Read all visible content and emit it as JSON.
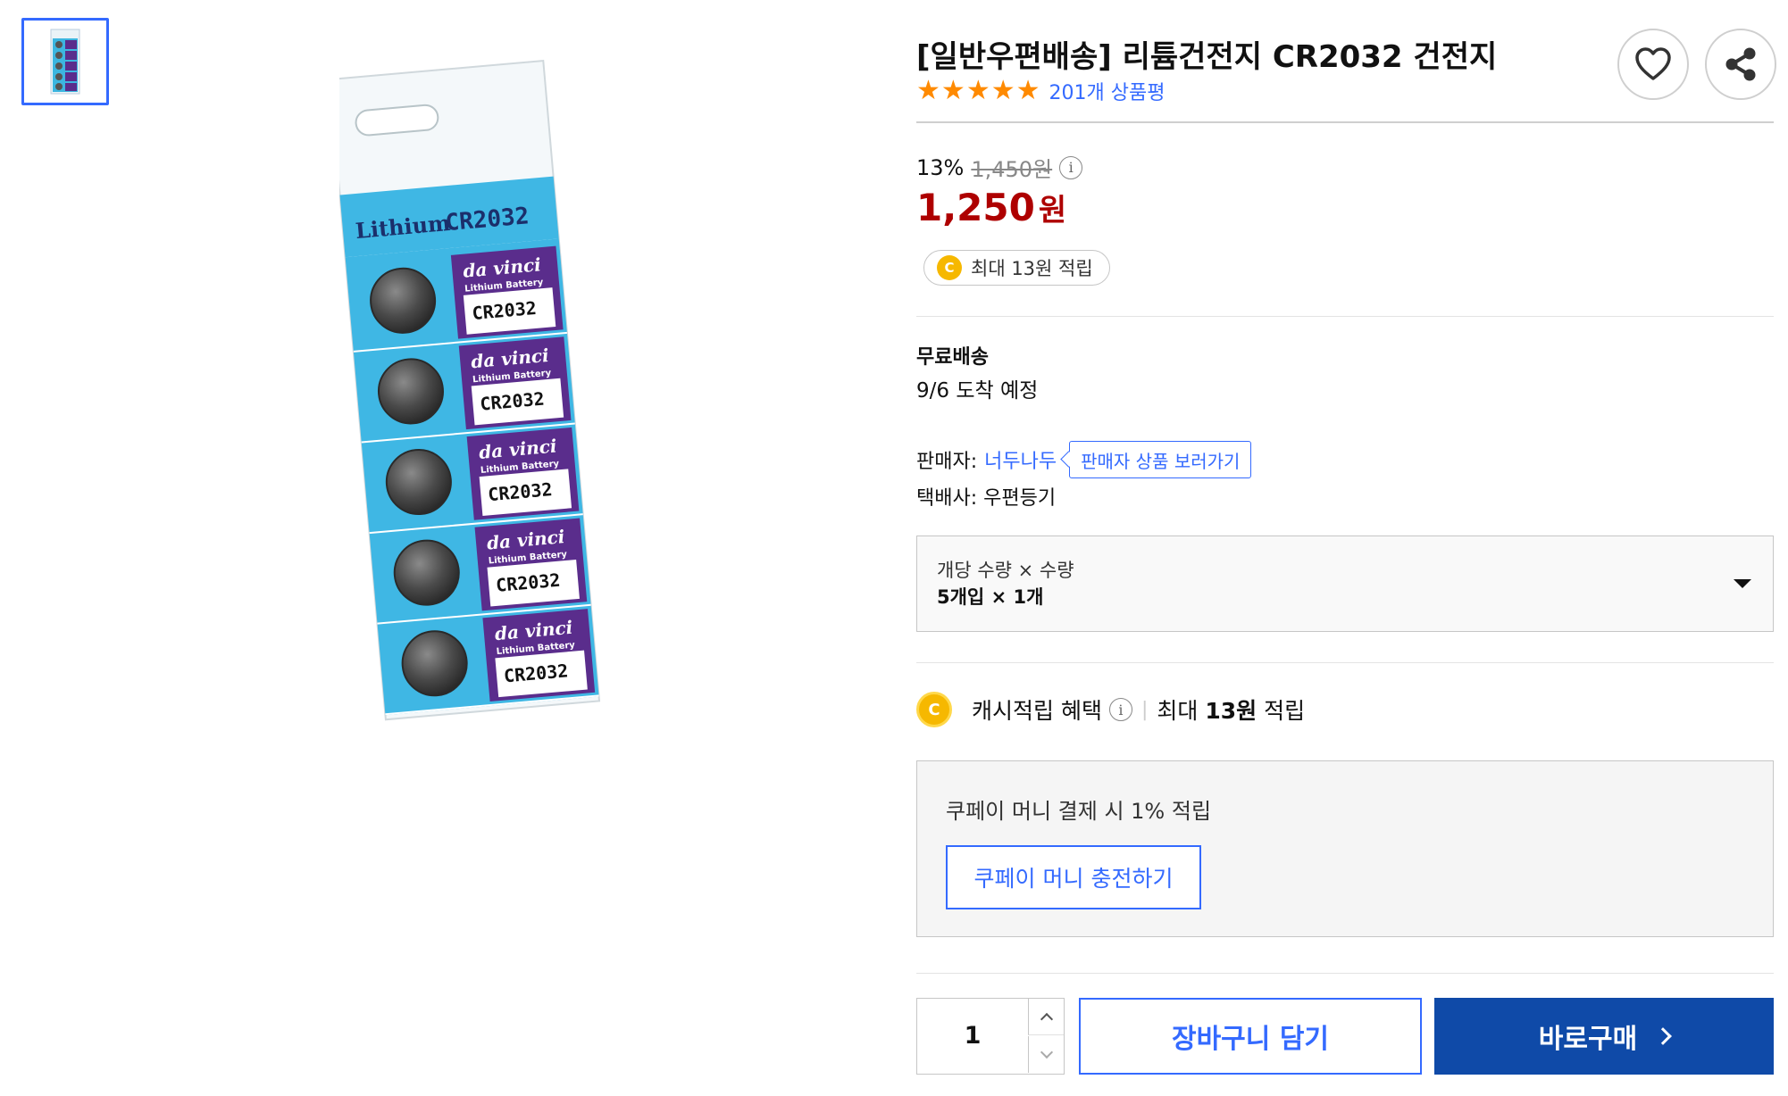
{
  "gallery": {
    "brand_label": "Lithium",
    "model_label": "CR2032",
    "pack_brand": "da vinci",
    "pack_sub": "Lithium Battery",
    "cells": 5
  },
  "product": {
    "title": "[일반우편배송] 리튬건전지 CR2032 건전지",
    "rating": 5,
    "review_count": "201개 상품평"
  },
  "price": {
    "discount_rate": "13%",
    "original": "1,450원",
    "sale_number": "1,250",
    "sale_unit": "원",
    "cash_badge": "최대 13원 적립",
    "coin_letter": "C"
  },
  "shipping": {
    "title": "무료배송",
    "arrival": "9/6 도착 예정"
  },
  "seller": {
    "label": "판매자:",
    "name": "너두나두",
    "link": "판매자 상품 보러가기",
    "courier": "택배사: 우편등기"
  },
  "option": {
    "label": "개당 수량 × 수량",
    "value": "5개입 × 1개"
  },
  "cash_benefit": {
    "label": "캐시적립 혜택",
    "amount_prefix": "최대 ",
    "amount_bold": "13원",
    "amount_suffix": " 적립"
  },
  "coupay": {
    "text": "쿠페이 머니 결제 시 1% 적립",
    "button": "쿠페이 머니 충전하기"
  },
  "purchase": {
    "quantity": "1",
    "cart_button": "장바구니 담기",
    "buy_button": "바로구매"
  },
  "colors": {
    "accent_blue": "#346aff",
    "buy_blue": "#0f4aa8",
    "price_red": "#ae0000",
    "star_orange": "#ff8a00",
    "coin_yellow": "#f6b800"
  },
  "icons": [
    "heart-icon",
    "share-icon",
    "info-icon",
    "coin-icon",
    "chevron-down-icon",
    "chevron-up-icon",
    "chevron-right-icon",
    "star-icon"
  ]
}
